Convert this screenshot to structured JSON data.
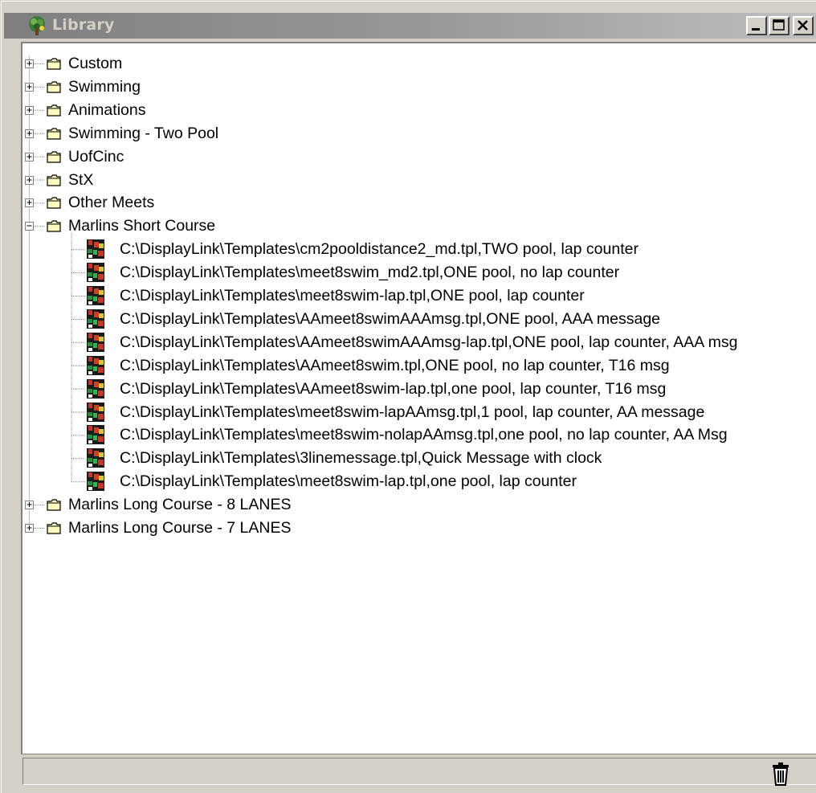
{
  "window": {
    "title": "Library",
    "title_icon": "tree-app-icon",
    "controls": [
      "minimize-icon",
      "maximize-icon",
      "close-icon"
    ]
  },
  "tree": {
    "folders_top": [
      {
        "label": "Custom",
        "state": "collapsed"
      },
      {
        "label": "Swimming",
        "state": "collapsed"
      },
      {
        "label": "Animations",
        "state": "collapsed"
      },
      {
        "label": "Swimming - Two Pool",
        "state": "collapsed"
      },
      {
        "label": "UofCinc",
        "state": "collapsed"
      },
      {
        "label": "StX",
        "state": "collapsed"
      },
      {
        "label": "Other Meets",
        "state": "collapsed"
      },
      {
        "label": "Marlins Short Course",
        "state": "expanded"
      }
    ],
    "children": [
      {
        "label": "C:\\DisplayLink\\Templates\\cm2pooldistance2_md.tpl,TWO pool, lap counter"
      },
      {
        "label": "C:\\DisplayLink\\Templates\\meet8swim_md2.tpl,ONE pool, no lap counter"
      },
      {
        "label": "C:\\DisplayLink\\Templates\\meet8swim-lap.tpl,ONE pool, lap counter"
      },
      {
        "label": "C:\\DisplayLink\\Templates\\AAmeet8swimAAAmsg.tpl,ONE pool, AAA message"
      },
      {
        "label": "C:\\DisplayLink\\Templates\\AAmeet8swimAAAmsg-lap.tpl,ONE pool, lap counter, AAA msg"
      },
      {
        "label": "C:\\DisplayLink\\Templates\\AAmeet8swim.tpl,ONE pool, no lap counter, T16 msg"
      },
      {
        "label": "C:\\DisplayLink\\Templates\\AAmeet8swim-lap.tpl,one pool, lap counter, T16 msg"
      },
      {
        "label": "C:\\DisplayLink\\Templates\\meet8swim-lapAAmsg.tpl,1 pool, lap counter, AA message"
      },
      {
        "label": "C:\\DisplayLink\\Templates\\meet8swim-nolapAAmsg.tpl,one pool, no lap counter, AA Msg"
      },
      {
        "label": "C:\\DisplayLink\\Templates\\3linemessage.tpl,Quick Message with clock"
      },
      {
        "label": "C:\\DisplayLink\\Templates\\meet8swim-lap.tpl,one pool, lap counter"
      }
    ],
    "folders_bottom": [
      {
        "label": "Marlins Long Course - 8 LANES",
        "state": "collapsed"
      },
      {
        "label": "Marlins Long Course - 7 LANES",
        "state": "collapsed"
      }
    ]
  },
  "statusbar": {
    "trash_icon": "trash-icon"
  },
  "colors": {
    "titlebar_inactive": "#808080",
    "face": "#d4d0c8",
    "folder": "#fffbc0"
  }
}
